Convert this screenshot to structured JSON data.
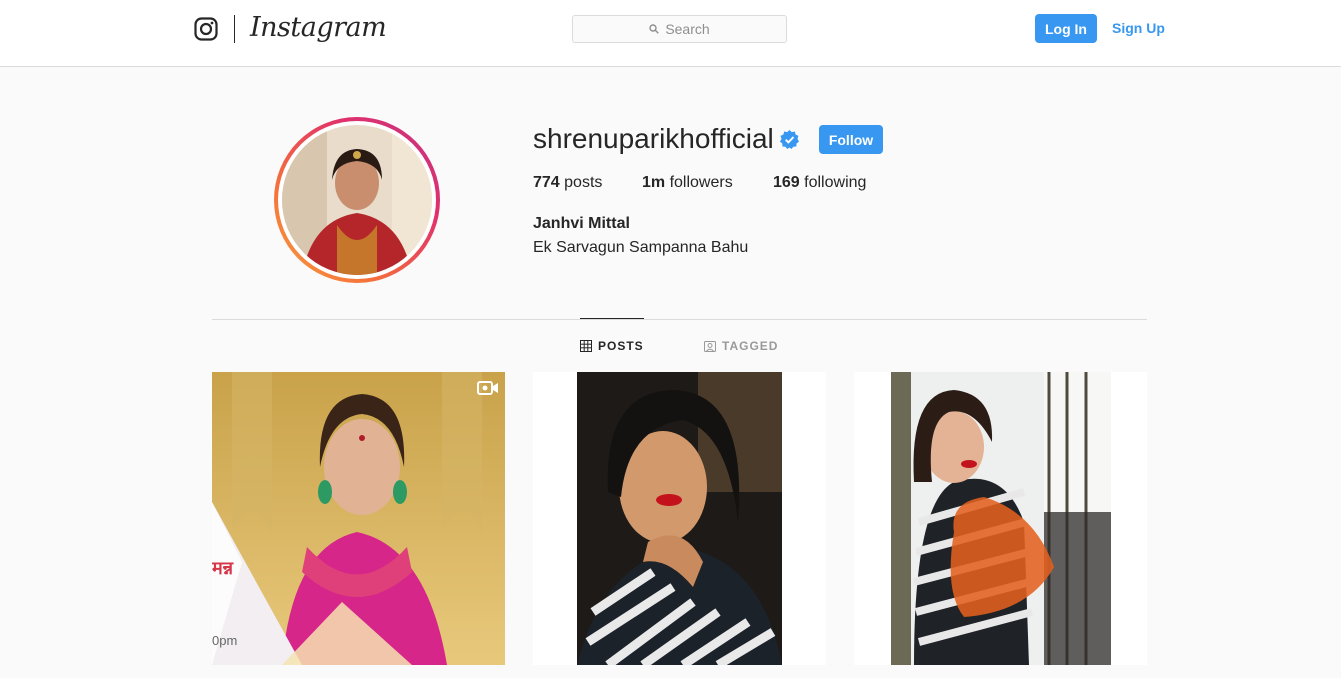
{
  "nav": {
    "brand": "Instagram",
    "search_placeholder": "Search",
    "login_label": "Log In",
    "signup_label": "Sign Up"
  },
  "profile": {
    "username": "shrenuparikhofficial",
    "verified": true,
    "follow_label": "Follow",
    "posts_count": "774",
    "posts_label": "posts",
    "followers_count": "1m",
    "followers_label": "followers",
    "following_count": "169",
    "following_label": "following",
    "full_name": "Janhvi Mittal",
    "bio": "Ek Sarvagun Sampanna Bahu"
  },
  "tabs": [
    {
      "label": "POSTS",
      "icon": "grid-icon",
      "active": true
    },
    {
      "label": "TAGGED",
      "icon": "tag-portrait-icon",
      "active": false
    }
  ],
  "posts": [
    {
      "type": "video",
      "overlay_text_1": "मन्न",
      "overlay_text_2": "0pm"
    },
    {
      "type": "photo"
    },
    {
      "type": "photo"
    }
  ],
  "colors": {
    "accent": "#3897f0",
    "border": "#dbdbdb",
    "background": "#fafafa"
  }
}
